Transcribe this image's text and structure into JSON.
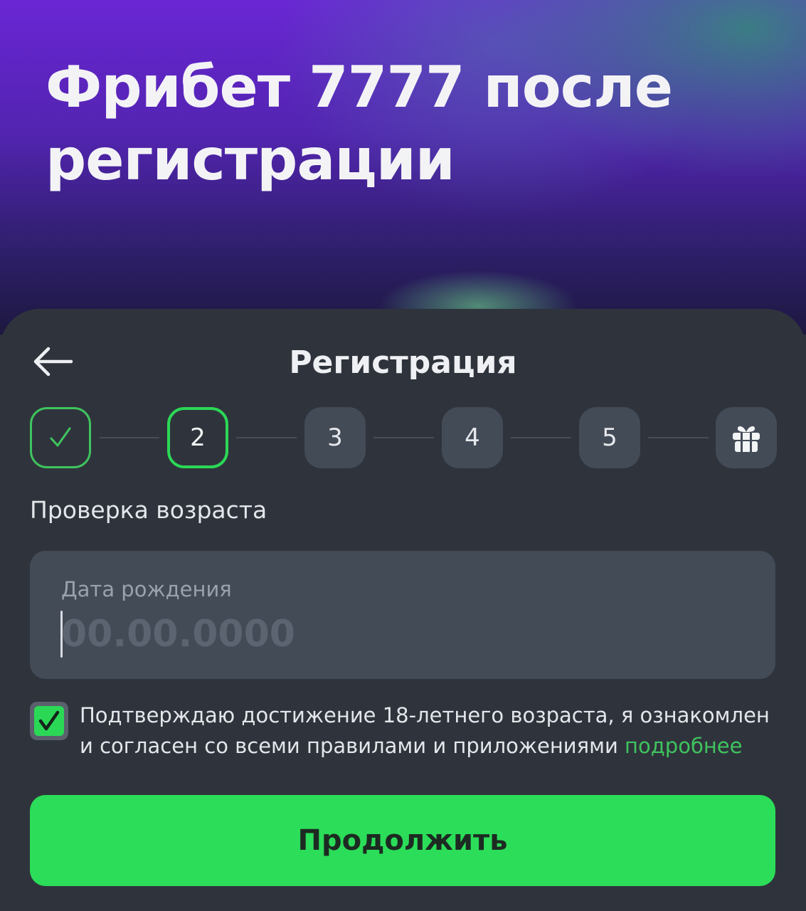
{
  "hero": {
    "title_line1": "Фрибет 7777 после",
    "title_line2": "регистрации"
  },
  "sheet": {
    "title": "Регистрация",
    "back_icon": "arrow-left-icon"
  },
  "steps": [
    {
      "label": "",
      "state": "done",
      "icon": "check-icon"
    },
    {
      "label": "2",
      "state": "active"
    },
    {
      "label": "3",
      "state": "pending"
    },
    {
      "label": "4",
      "state": "pending"
    },
    {
      "label": "5",
      "state": "pending"
    },
    {
      "label": "",
      "state": "pending",
      "icon": "gift-icon"
    }
  ],
  "section": {
    "label": "Проверка возраста"
  },
  "birthdate": {
    "label": "Дата рождения",
    "placeholder": "00.00.0000",
    "value": ""
  },
  "agreement": {
    "checked": true,
    "text": "Подтверждаю достижение 18-летнего возраста, я ознакомлен и согласен со всеми правилами и приложениями",
    "link_text": "подробнее"
  },
  "continue": {
    "label": "Продолжить"
  },
  "colors": {
    "accent_green": "#2bdd58",
    "link_green": "#3fc45e",
    "sheet_bg": "#2f343c",
    "field_bg": "#434b57"
  }
}
